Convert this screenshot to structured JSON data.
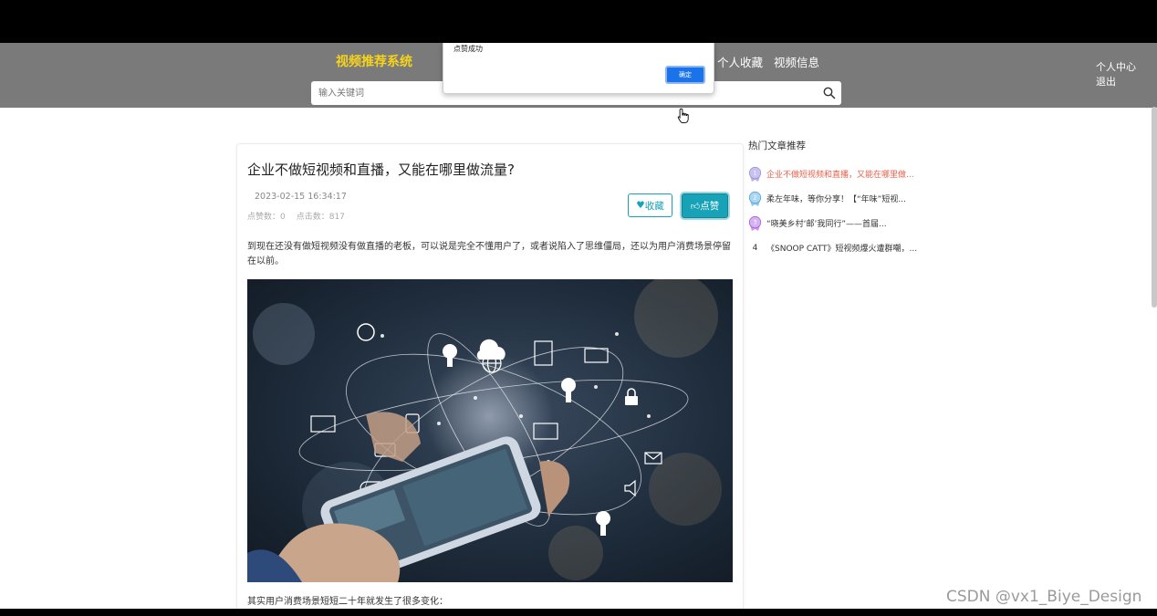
{
  "header": {
    "brand": "视频推荐系统",
    "nav": [
      "个人收藏",
      "视频信息"
    ],
    "user_menu": [
      "个人中心",
      "退出"
    ],
    "search_placeholder": "输入关键词"
  },
  "alert": {
    "message": "点赞成功",
    "confirm_label": "确定"
  },
  "article": {
    "title": "企业不做短视频和直播，又能在哪里做流量?",
    "date": "2023-02-15 16:34:17",
    "like_count_text": "点赞数：0",
    "click_count_text": "点击数：817",
    "favorite_label": "收藏",
    "like_label": "点赞",
    "paragraph1": "到现在还没有做短视频没有做直播的老板，可以说是完全不懂用户了，或者说陷入了思维僵局，还以为用户消费场景停留在以前。",
    "paragraph2": "其实用户消费场景短短二十年就发生了很多变化："
  },
  "sidebar": {
    "title": "热门文章推荐",
    "items": [
      {
        "rank": "1",
        "text": "企业不做短视频和直播，又能在哪里做...",
        "color": "#e8604c"
      },
      {
        "rank": "2",
        "text": "柔左年味，等你分享！【“年味”短视...",
        "color": "#5b9bd5"
      },
      {
        "rank": "3",
        "text": "“晓美乡村‘邮’我同行”——首届...",
        "color": "#a05ad6"
      },
      {
        "rank": "4",
        "text": "《SNOOP CATT》短视频爆火遭群嘲，..."
      }
    ]
  },
  "watermark": "CSDN @vx1_Biye_Design",
  "colors": {
    "header_bg": "#7a7a7a",
    "brand": "#f5d31c",
    "accent": "#17a2b8",
    "alert_button": "#1a73e8",
    "hot_active": "#e8604c"
  }
}
